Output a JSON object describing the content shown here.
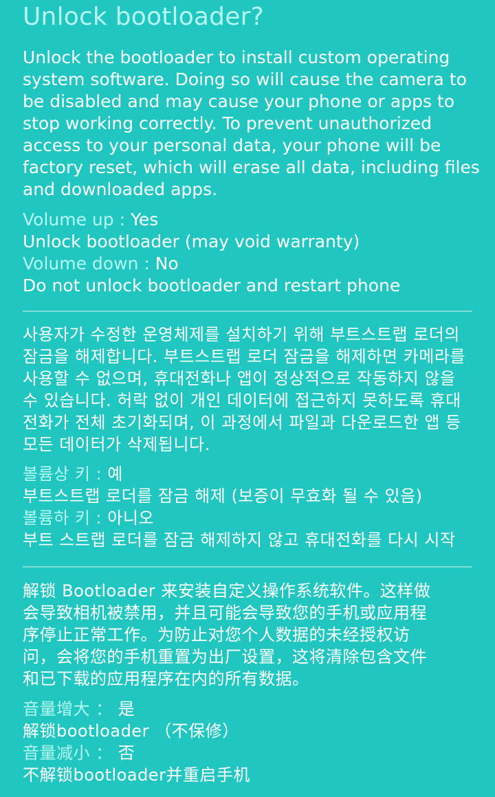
{
  "colors": {
    "background": "#22c6c0",
    "accent_text": "#b6f7f1",
    "body_text": "#ffffff",
    "divider": "#7fded8"
  },
  "title": "Unlock bootloader?",
  "english": {
    "body_lines": [
      "Unlock the bootloader to install custom operating",
      "system software. Doing so will cause the camera to",
      "be disabled and may cause your phone or apps to",
      "stop working correctly. To prevent unauthorized",
      "access to your personal data, your phone will be",
      "factory reset, which will erase all data, including files",
      "and downloaded apps."
    ],
    "volume_up_key": "Volume up : ",
    "volume_up_value": "Yes",
    "volume_up_desc": "Unlock bootloader (may void warranty)",
    "volume_down_key": "Volume down : ",
    "volume_down_value": "No",
    "volume_down_desc": "Do not unlock bootloader and restart phone"
  },
  "korean": {
    "body_lines": [
      "사용자가 수정한 운영체제를 설치하기 위해 부트스트랩 로더의",
      "잠금을 해제합니다. 부트스트랩 로더 잠금을 해제하면 카메라를",
      "사용할 수 없으며, 휴대전화나 앱이 정상적으로 작동하지 않을",
      "수 있습니다. 허락 없이 개인 데이터에 접근하지 못하도록 휴대",
      "전화가 전체 초기화되며, 이 과정에서 파일과 다운로드한 앱 등",
      "모든 데이터가 삭제됩니다."
    ],
    "volume_up_key": "볼륨상 키 : ",
    "volume_up_value": "예",
    "volume_up_desc": "부트스트랩 로더를 잠금 해제 (보증이 무효화 될 수 있음)",
    "volume_down_key": "볼륨하 키 : ",
    "volume_down_value": "아니오",
    "volume_down_desc": "부트 스트랩 로더를 잠금 해제하지 않고 휴대전화를 다시 시작"
  },
  "chinese": {
    "body_lines": [
      "解锁 Bootloader 来安装自定义操作系统软件。这样做",
      "会导致相机被禁用，并且可能会导致您的手机或应用程",
      "序停止正常工作。为防止对您个人数据的未经授权访",
      "问，会将您的手机重置为出厂设置，这将清除包含文件",
      "和已下载的应用程序在内的所有数据。"
    ],
    "volume_up_key": "音量增大 ： ",
    "volume_up_value": "是",
    "volume_up_desc": "解锁bootloader （不保修）",
    "volume_down_key": "音量减小 ： ",
    "volume_down_value": "否",
    "volume_down_desc": "不解锁bootloader并重启手机"
  }
}
